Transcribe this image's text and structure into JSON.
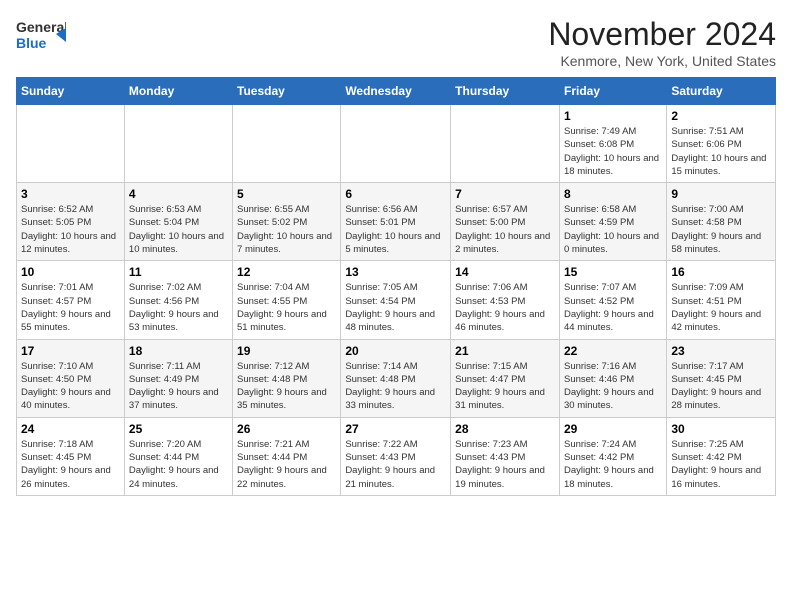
{
  "header": {
    "logo_line1": "General",
    "logo_line2": "Blue",
    "month_title": "November 2024",
    "location": "Kenmore, New York, United States"
  },
  "days_of_week": [
    "Sunday",
    "Monday",
    "Tuesday",
    "Wednesday",
    "Thursday",
    "Friday",
    "Saturday"
  ],
  "weeks": [
    [
      {
        "day": "",
        "info": ""
      },
      {
        "day": "",
        "info": ""
      },
      {
        "day": "",
        "info": ""
      },
      {
        "day": "",
        "info": ""
      },
      {
        "day": "",
        "info": ""
      },
      {
        "day": "1",
        "info": "Sunrise: 7:49 AM\nSunset: 6:08 PM\nDaylight: 10 hours and 18 minutes."
      },
      {
        "day": "2",
        "info": "Sunrise: 7:51 AM\nSunset: 6:06 PM\nDaylight: 10 hours and 15 minutes."
      }
    ],
    [
      {
        "day": "3",
        "info": "Sunrise: 6:52 AM\nSunset: 5:05 PM\nDaylight: 10 hours and 12 minutes."
      },
      {
        "day": "4",
        "info": "Sunrise: 6:53 AM\nSunset: 5:04 PM\nDaylight: 10 hours and 10 minutes."
      },
      {
        "day": "5",
        "info": "Sunrise: 6:55 AM\nSunset: 5:02 PM\nDaylight: 10 hours and 7 minutes."
      },
      {
        "day": "6",
        "info": "Sunrise: 6:56 AM\nSunset: 5:01 PM\nDaylight: 10 hours and 5 minutes."
      },
      {
        "day": "7",
        "info": "Sunrise: 6:57 AM\nSunset: 5:00 PM\nDaylight: 10 hours and 2 minutes."
      },
      {
        "day": "8",
        "info": "Sunrise: 6:58 AM\nSunset: 4:59 PM\nDaylight: 10 hours and 0 minutes."
      },
      {
        "day": "9",
        "info": "Sunrise: 7:00 AM\nSunset: 4:58 PM\nDaylight: 9 hours and 58 minutes."
      }
    ],
    [
      {
        "day": "10",
        "info": "Sunrise: 7:01 AM\nSunset: 4:57 PM\nDaylight: 9 hours and 55 minutes."
      },
      {
        "day": "11",
        "info": "Sunrise: 7:02 AM\nSunset: 4:56 PM\nDaylight: 9 hours and 53 minutes."
      },
      {
        "day": "12",
        "info": "Sunrise: 7:04 AM\nSunset: 4:55 PM\nDaylight: 9 hours and 51 minutes."
      },
      {
        "day": "13",
        "info": "Sunrise: 7:05 AM\nSunset: 4:54 PM\nDaylight: 9 hours and 48 minutes."
      },
      {
        "day": "14",
        "info": "Sunrise: 7:06 AM\nSunset: 4:53 PM\nDaylight: 9 hours and 46 minutes."
      },
      {
        "day": "15",
        "info": "Sunrise: 7:07 AM\nSunset: 4:52 PM\nDaylight: 9 hours and 44 minutes."
      },
      {
        "day": "16",
        "info": "Sunrise: 7:09 AM\nSunset: 4:51 PM\nDaylight: 9 hours and 42 minutes."
      }
    ],
    [
      {
        "day": "17",
        "info": "Sunrise: 7:10 AM\nSunset: 4:50 PM\nDaylight: 9 hours and 40 minutes."
      },
      {
        "day": "18",
        "info": "Sunrise: 7:11 AM\nSunset: 4:49 PM\nDaylight: 9 hours and 37 minutes."
      },
      {
        "day": "19",
        "info": "Sunrise: 7:12 AM\nSunset: 4:48 PM\nDaylight: 9 hours and 35 minutes."
      },
      {
        "day": "20",
        "info": "Sunrise: 7:14 AM\nSunset: 4:48 PM\nDaylight: 9 hours and 33 minutes."
      },
      {
        "day": "21",
        "info": "Sunrise: 7:15 AM\nSunset: 4:47 PM\nDaylight: 9 hours and 31 minutes."
      },
      {
        "day": "22",
        "info": "Sunrise: 7:16 AM\nSunset: 4:46 PM\nDaylight: 9 hours and 30 minutes."
      },
      {
        "day": "23",
        "info": "Sunrise: 7:17 AM\nSunset: 4:45 PM\nDaylight: 9 hours and 28 minutes."
      }
    ],
    [
      {
        "day": "24",
        "info": "Sunrise: 7:18 AM\nSunset: 4:45 PM\nDaylight: 9 hours and 26 minutes."
      },
      {
        "day": "25",
        "info": "Sunrise: 7:20 AM\nSunset: 4:44 PM\nDaylight: 9 hours and 24 minutes."
      },
      {
        "day": "26",
        "info": "Sunrise: 7:21 AM\nSunset: 4:44 PM\nDaylight: 9 hours and 22 minutes."
      },
      {
        "day": "27",
        "info": "Sunrise: 7:22 AM\nSunset: 4:43 PM\nDaylight: 9 hours and 21 minutes."
      },
      {
        "day": "28",
        "info": "Sunrise: 7:23 AM\nSunset: 4:43 PM\nDaylight: 9 hours and 19 minutes."
      },
      {
        "day": "29",
        "info": "Sunrise: 7:24 AM\nSunset: 4:42 PM\nDaylight: 9 hours and 18 minutes."
      },
      {
        "day": "30",
        "info": "Sunrise: 7:25 AM\nSunset: 4:42 PM\nDaylight: 9 hours and 16 minutes."
      }
    ]
  ]
}
